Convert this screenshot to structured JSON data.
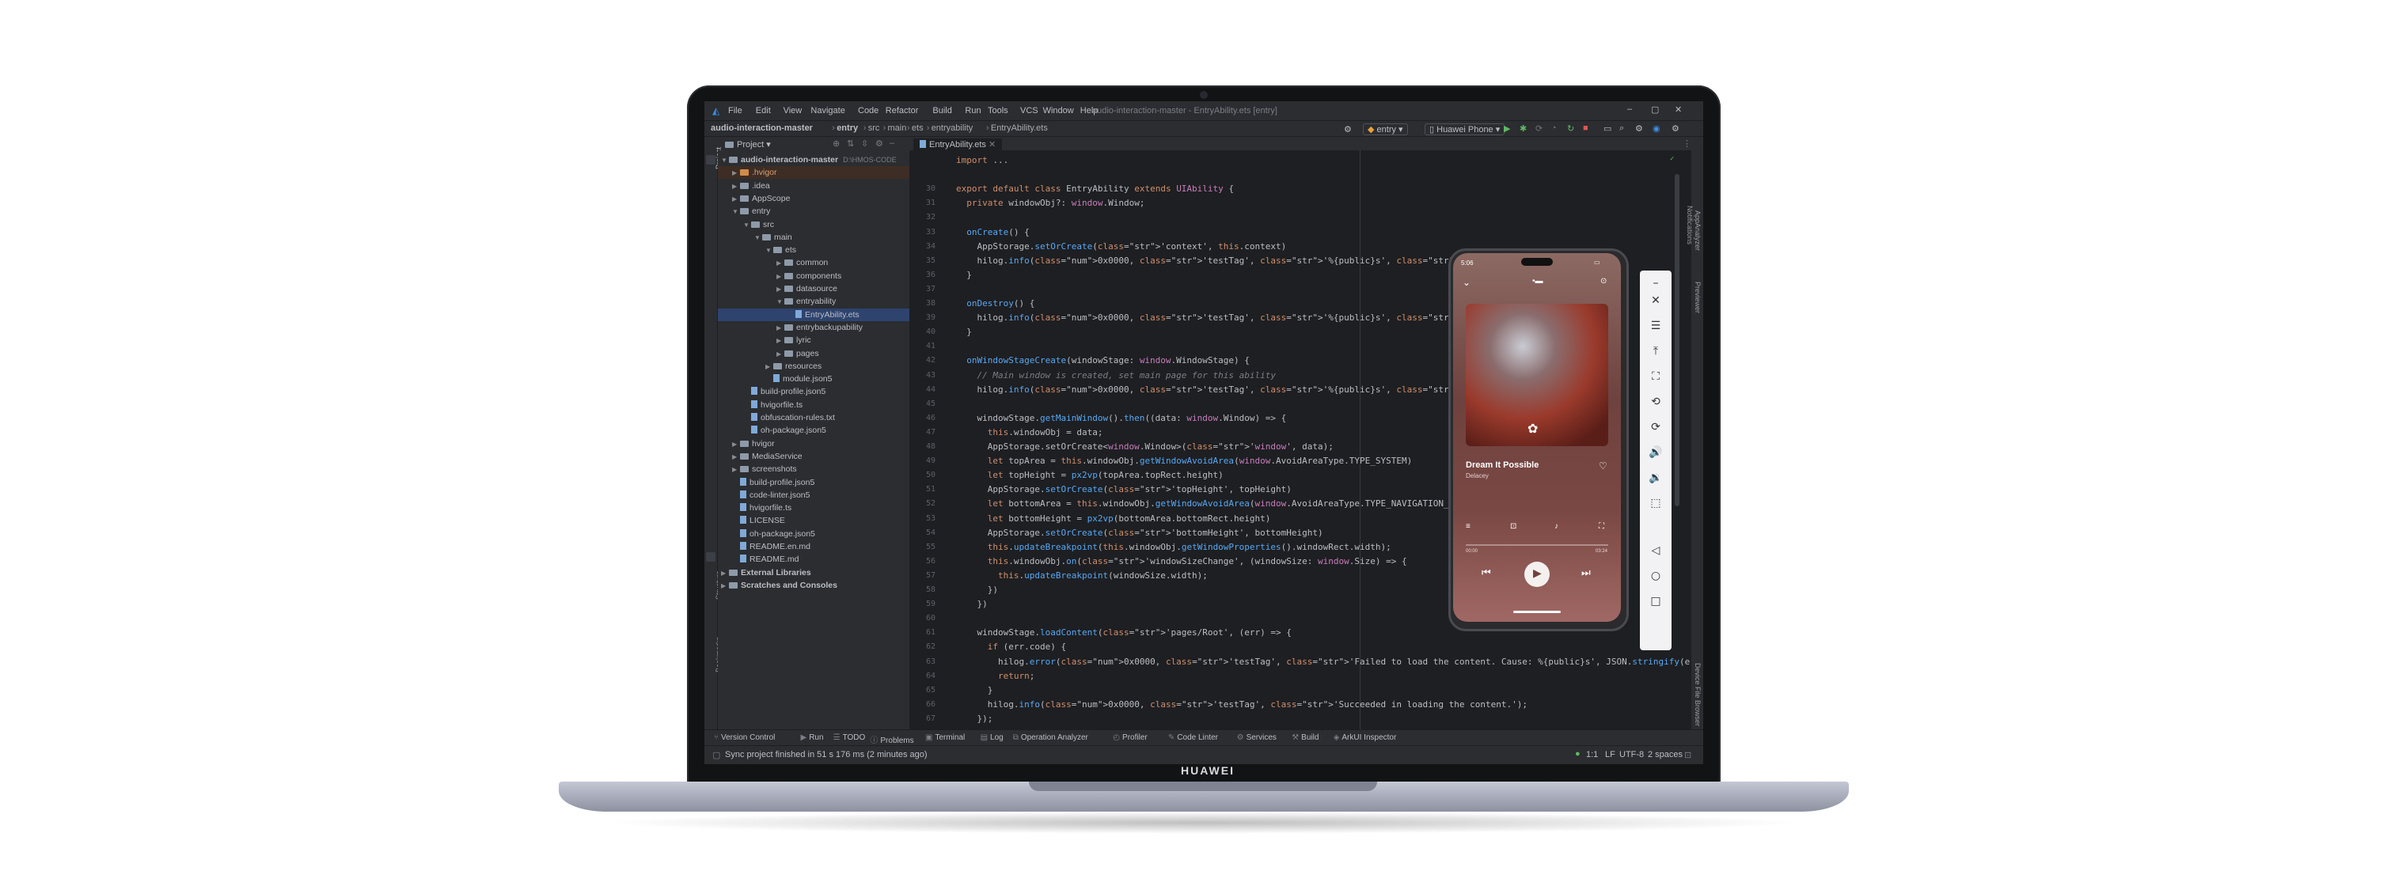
{
  "device_brand": "HUAWEI",
  "window": {
    "menu": [
      "File",
      "Edit",
      "View",
      "Navigate",
      "Code",
      "Refactor",
      "Build",
      "Run",
      "Tools",
      "VCS",
      "Window",
      "Help"
    ],
    "title": "audio-interaction-master - EntryAbility.ets [entry]"
  },
  "nav": {
    "breadcrumb": [
      "audio-interaction-master",
      "entry",
      "src",
      "main",
      "ets",
      "entryability",
      "EntryAbility.ets"
    ],
    "run_config": "entry",
    "device": "Huawei Phone"
  },
  "project_panel": {
    "title": "Project",
    "tab_label": "Project",
    "bottom_tabs": [
      "Structure",
      "Bookmarks"
    ],
    "tree": [
      {
        "label": "audio-interaction-master",
        "depth": 0,
        "kind": "folder",
        "open": true,
        "suffix": "D:\\HMOS-CODE"
      },
      {
        "label": ".hvigor",
        "depth": 1,
        "kind": "folder",
        "open": false,
        "highlight": true
      },
      {
        "label": ".idea",
        "depth": 1,
        "kind": "folder",
        "open": false
      },
      {
        "label": "AppScope",
        "depth": 1,
        "kind": "folder",
        "open": false
      },
      {
        "label": "entry",
        "depth": 1,
        "kind": "folder",
        "open": true
      },
      {
        "label": "src",
        "depth": 2,
        "kind": "folder",
        "open": true
      },
      {
        "label": "main",
        "depth": 3,
        "kind": "folder",
        "open": true
      },
      {
        "label": "ets",
        "depth": 4,
        "kind": "folder",
        "open": true
      },
      {
        "label": "common",
        "depth": 5,
        "kind": "folder",
        "open": false
      },
      {
        "label": "components",
        "depth": 5,
        "kind": "folder",
        "open": false
      },
      {
        "label": "datasource",
        "depth": 5,
        "kind": "folder",
        "open": false
      },
      {
        "label": "entryability",
        "depth": 5,
        "kind": "folder",
        "open": true
      },
      {
        "label": "EntryAbility.ets",
        "depth": 6,
        "kind": "file",
        "selected": true
      },
      {
        "label": "entrybackupability",
        "depth": 5,
        "kind": "folder",
        "open": false
      },
      {
        "label": "lyric",
        "depth": 5,
        "kind": "folder",
        "open": false
      },
      {
        "label": "pages",
        "depth": 5,
        "kind": "folder",
        "open": false
      },
      {
        "label": "resources",
        "depth": 4,
        "kind": "folder",
        "open": false
      },
      {
        "label": "module.json5",
        "depth": 4,
        "kind": "file"
      },
      {
        "label": "build-profile.json5",
        "depth": 2,
        "kind": "file"
      },
      {
        "label": "hvigorfile.ts",
        "depth": 2,
        "kind": "file"
      },
      {
        "label": "obfuscation-rules.txt",
        "depth": 2,
        "kind": "file"
      },
      {
        "label": "oh-package.json5",
        "depth": 2,
        "kind": "file"
      },
      {
        "label": "hvigor",
        "depth": 1,
        "kind": "folder",
        "open": false
      },
      {
        "label": "MediaService",
        "depth": 1,
        "kind": "folder",
        "open": false
      },
      {
        "label": "screenshots",
        "depth": 1,
        "kind": "folder",
        "open": false
      },
      {
        "label": "build-profile.json5",
        "depth": 1,
        "kind": "file"
      },
      {
        "label": "code-linter.json5",
        "depth": 1,
        "kind": "file"
      },
      {
        "label": "hvigorfile.ts",
        "depth": 1,
        "kind": "file"
      },
      {
        "label": "LICENSE",
        "depth": 1,
        "kind": "file"
      },
      {
        "label": "oh-package.json5",
        "depth": 1,
        "kind": "file"
      },
      {
        "label": "README.en.md",
        "depth": 1,
        "kind": "file"
      },
      {
        "label": "README.md",
        "depth": 1,
        "kind": "file"
      },
      {
        "label": "External Libraries",
        "depth": 0,
        "kind": "folder",
        "open": false
      },
      {
        "label": "Scratches and Consoles",
        "depth": 0,
        "kind": "folder",
        "open": false
      }
    ]
  },
  "editor": {
    "tab": "EntryAbility.ets",
    "lines": [
      {
        "n": "",
        "t": "import ..."
      },
      {
        "n": "",
        "t": ""
      },
      {
        "n": "30",
        "t": "export default class EntryAbility extends UIAbility {"
      },
      {
        "n": "31",
        "t": "  private windowObj?: window.Window;"
      },
      {
        "n": "32",
        "t": ""
      },
      {
        "n": "33",
        "t": "  onCreate() {"
      },
      {
        "n": "34",
        "t": "    AppStorage.setOrCreate('context', this.context)"
      },
      {
        "n": "35",
        "t": "    hilog.info(0x0000, 'testTag', '%{public}s', 'Ability onCreate');"
      },
      {
        "n": "36",
        "t": "  }"
      },
      {
        "n": "37",
        "t": ""
      },
      {
        "n": "38",
        "t": "  onDestroy() {"
      },
      {
        "n": "39",
        "t": "    hilog.info(0x0000, 'testTag', '%{public}s', 'Ability onDestroy');"
      },
      {
        "n": "40",
        "t": "  }"
      },
      {
        "n": "41",
        "t": ""
      },
      {
        "n": "42",
        "t": "  onWindowStageCreate(windowStage: window.WindowStage) {"
      },
      {
        "n": "43",
        "t": "    // Main window is created, set main page for this ability"
      },
      {
        "n": "44",
        "t": "    hilog.info(0x0000, 'testTag', '%{public}s', 'Ability onWindowStageCreate');"
      },
      {
        "n": "45",
        "t": ""
      },
      {
        "n": "46",
        "t": "    windowStage.getMainWindow().then((data: window.Window) => {"
      },
      {
        "n": "47",
        "t": "      this.windowObj = data;"
      },
      {
        "n": "48",
        "t": "      AppStorage.setOrCreate<window.Window>('window', data);"
      },
      {
        "n": "49",
        "t": "      let topArea = this.windowObj.getWindowAvoidArea(window.AvoidAreaType.TYPE_SYSTEM)"
      },
      {
        "n": "50",
        "t": "      let topHeight = px2vp(topArea.topRect.height)"
      },
      {
        "n": "51",
        "t": "      AppStorage.setOrCreate('topHeight', topHeight)"
      },
      {
        "n": "52",
        "t": "      let bottomArea = this.windowObj.getWindowAvoidArea(window.AvoidAreaType.TYPE_NAVIGATION_INDICATOR)"
      },
      {
        "n": "53",
        "t": "      let bottomHeight = px2vp(bottomArea.bottomRect.height)"
      },
      {
        "n": "54",
        "t": "      AppStorage.setOrCreate('bottomHeight', bottomHeight)"
      },
      {
        "n": "55",
        "t": "      this.updateBreakpoint(this.windowObj.getWindowProperties().windowRect.width);"
      },
      {
        "n": "56",
        "t": "      this.windowObj.on('windowSizeChange', (windowSize: window.Size) => {"
      },
      {
        "n": "57",
        "t": "        this.updateBreakpoint(windowSize.width);"
      },
      {
        "n": "58",
        "t": "      })"
      },
      {
        "n": "59",
        "t": "    })"
      },
      {
        "n": "60",
        "t": ""
      },
      {
        "n": "61",
        "t": "    windowStage.loadContent('pages/Root', (err) => {"
      },
      {
        "n": "62",
        "t": "      if (err.code) {"
      },
      {
        "n": "63",
        "t": "        hilog.error(0x0000, 'testTag', 'Failed to load the content. Cause: %{public}s', JSON.stringify(err) ?? '');"
      },
      {
        "n": "64",
        "t": "        return;"
      },
      {
        "n": "65",
        "t": "      }"
      },
      {
        "n": "66",
        "t": "      hilog.info(0x0000, 'testTag', 'Succeeded in loading the content.');"
      },
      {
        "n": "67",
        "t": "    });"
      }
    ]
  },
  "phone": {
    "time": "5:06",
    "song_title": "Dream It Possible",
    "artist": "Delacey",
    "time_start": "00:00",
    "time_end": "03:24",
    "progress": 0
  },
  "emulator_tools": [
    "–",
    "✕",
    "☰",
    "⤒",
    "⛶",
    "⟲",
    "⟳",
    "🔊",
    "🔉",
    "⬚",
    "◁",
    "○",
    "□"
  ],
  "right_side_tabs": [
    "Notifications",
    "AppAnalyzer",
    "Previewer"
  ],
  "right_side_bottom": "Device File Browser",
  "tool_windows": [
    "Version Control",
    "Run",
    "TODO",
    "Problems",
    "Terminal",
    "Log",
    "Operation Analyzer",
    "Profiler",
    "Code Linter",
    "Services",
    "Build",
    "ArkUI Inspector"
  ],
  "status": {
    "message": "Sync project finished in 51 s 176 ms (2 minutes ago)",
    "position": "1:1",
    "line_sep": "LF",
    "encoding": "UTF-8",
    "indent": "2 spaces"
  }
}
